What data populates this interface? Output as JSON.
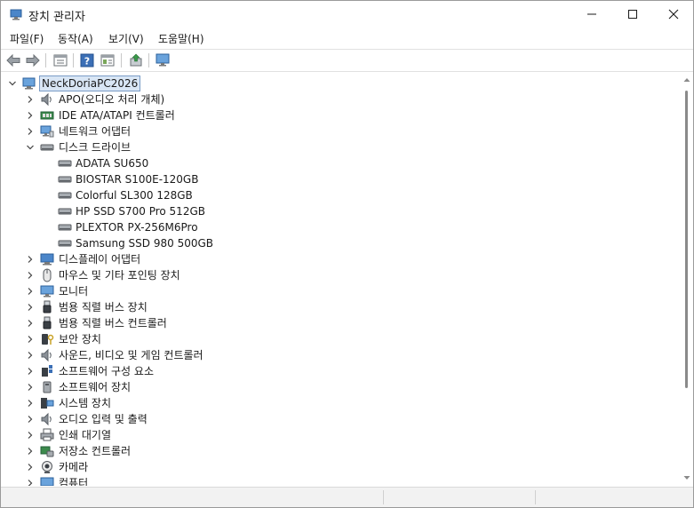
{
  "window": {
    "title": "장치 관리자"
  },
  "menu": [
    "파일(F)",
    "동작(A)",
    "보기(V)",
    "도움말(H)"
  ],
  "root": "NeckDoriaPC2026",
  "tree": [
    {
      "label": "APO(오디오 처리 개체)",
      "icon": "speaker-icon",
      "expanded": false
    },
    {
      "label": "IDE ATA/ATAPI 컨트롤러",
      "icon": "ide-controller-icon",
      "expanded": false
    },
    {
      "label": "네트워크 어댑터",
      "icon": "network-adapter-icon",
      "expanded": false
    },
    {
      "label": "디스크 드라이브",
      "icon": "disk-drive-icon",
      "expanded": true,
      "children": [
        "ADATA SU650",
        "BIOSTAR S100E-120GB",
        "Colorful SL300 128GB",
        "HP SSD S700 Pro 512GB",
        "PLEXTOR PX-256M6Pro",
        "Samsung SSD 980 500GB"
      ]
    },
    {
      "label": "디스플레이 어댑터",
      "icon": "display-adapter-icon",
      "expanded": false
    },
    {
      "label": "마우스 및 기타 포인팅 장치",
      "icon": "mouse-icon",
      "expanded": false
    },
    {
      "label": "모니터",
      "icon": "monitor-icon",
      "expanded": false
    },
    {
      "label": "범용 직렬 버스 장치",
      "icon": "usb-icon",
      "expanded": false
    },
    {
      "label": "범용 직렬 버스 컨트롤러",
      "icon": "usb-icon",
      "expanded": false
    },
    {
      "label": "보안 장치",
      "icon": "security-key-icon",
      "expanded": false
    },
    {
      "label": "사운드, 비디오 및 게임 컨트롤러",
      "icon": "speaker-icon",
      "expanded": false
    },
    {
      "label": "소프트웨어 구성 요소",
      "icon": "software-component-icon",
      "expanded": false
    },
    {
      "label": "소프트웨어 장치",
      "icon": "software-device-icon",
      "expanded": false
    },
    {
      "label": "시스템 장치",
      "icon": "system-device-icon",
      "expanded": false
    },
    {
      "label": "오디오 입력 및 출력",
      "icon": "speaker-icon",
      "expanded": false
    },
    {
      "label": "인쇄 대기열",
      "icon": "printer-icon",
      "expanded": false
    },
    {
      "label": "저장소 컨트롤러",
      "icon": "storage-controller-icon",
      "expanded": false
    },
    {
      "label": "카메라",
      "icon": "camera-icon",
      "expanded": false
    },
    {
      "label": "컴퓨터",
      "icon": "computer-icon",
      "expanded": false
    }
  ],
  "colors": {
    "accent": "#2f6fbd",
    "selection": "#d9e6f5"
  }
}
